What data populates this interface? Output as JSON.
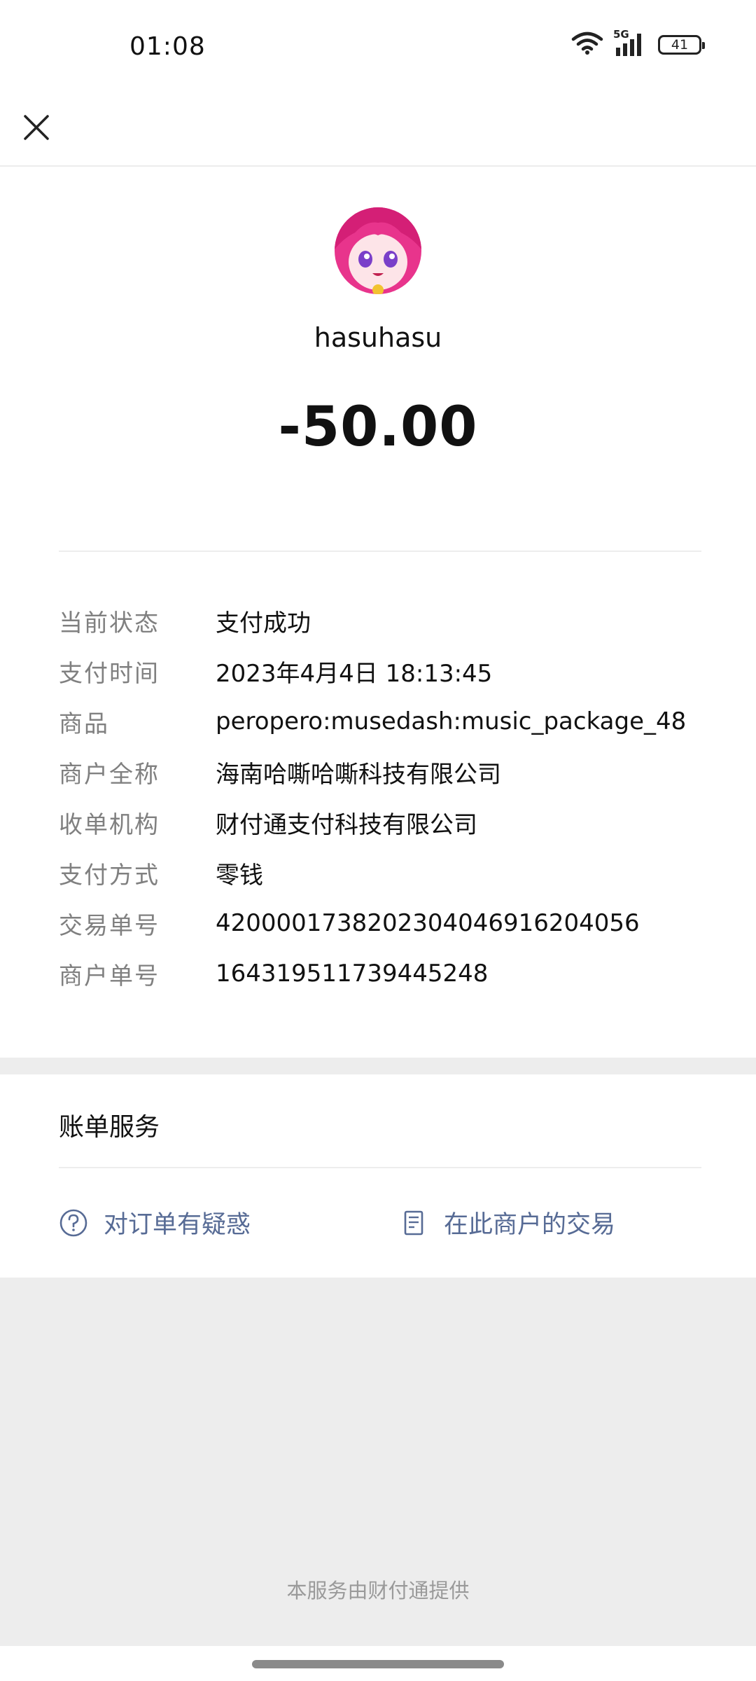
{
  "status_bar": {
    "time": "01:08",
    "network": "5G",
    "battery": "41",
    "icons": [
      "wifi-icon",
      "signal-icon",
      "battery-icon"
    ]
  },
  "nav": {
    "close_icon": "close-icon"
  },
  "payment": {
    "payee": "hasuhasu",
    "amount": "-50.00"
  },
  "details": [
    {
      "label": "当前状态",
      "value": "支付成功"
    },
    {
      "label": "支付时间",
      "value": "2023年4月4日 18:13:45"
    },
    {
      "label": "商品",
      "value": "peropero:musedash:music_package_48"
    },
    {
      "label": "商户全称",
      "value": "海南哈嘶哈嘶科技有限公司"
    },
    {
      "label": "收单机构",
      "value": "财付通支付科技有限公司"
    },
    {
      "label": "支付方式",
      "value": "零钱"
    },
    {
      "label": "交易单号",
      "value": "4200001738202304046916204056"
    },
    {
      "label": "商户单号",
      "value": "164319511739445248"
    }
  ],
  "services": {
    "title": "账单服务",
    "items": [
      {
        "label": "对订单有疑惑",
        "icon": "question-icon"
      },
      {
        "label": "在此商户的交易",
        "icon": "document-icon"
      }
    ]
  },
  "footer": {
    "provider": "本服务由财付通提供"
  },
  "colors": {
    "link": "#576b95",
    "label": "#808080",
    "background_gray": "#ededed"
  }
}
